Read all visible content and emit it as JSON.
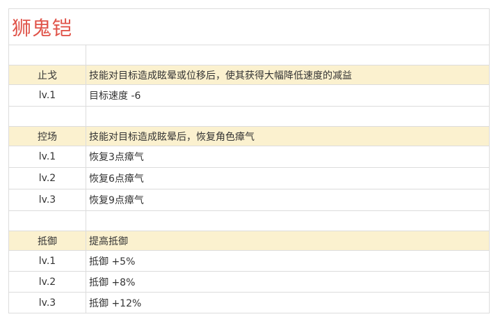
{
  "title": "狮鬼铠",
  "sections": [
    {
      "name": "止戈",
      "description": "技能对目标造成眩晕或位移后，使其获得大幅降低速度的减益",
      "levels": [
        {
          "level": "lv.1",
          "effect": "目标速度 -6"
        }
      ]
    },
    {
      "name": "控场",
      "description": "技能对目标造成眩晕后，恢复角色瘴气",
      "levels": [
        {
          "level": "lv.1",
          "effect": "恢复3点瘴气"
        },
        {
          "level": "lv.2",
          "effect": "恢复6点瘴气"
        },
        {
          "level": "lv.3",
          "effect": "恢复9点瘴气"
        }
      ]
    },
    {
      "name": "抵御",
      "description": "提高抵御",
      "levels": [
        {
          "level": "lv.1",
          "effect": "抵御 +5%"
        },
        {
          "level": "lv.2",
          "effect": "抵御 +8%"
        },
        {
          "level": "lv.3",
          "effect": "抵御 +12%"
        }
      ]
    }
  ],
  "colors": {
    "title": "#e0544a",
    "header_bg": "#fbf1cf",
    "border": "#dcdcdc",
    "text": "#333333"
  }
}
